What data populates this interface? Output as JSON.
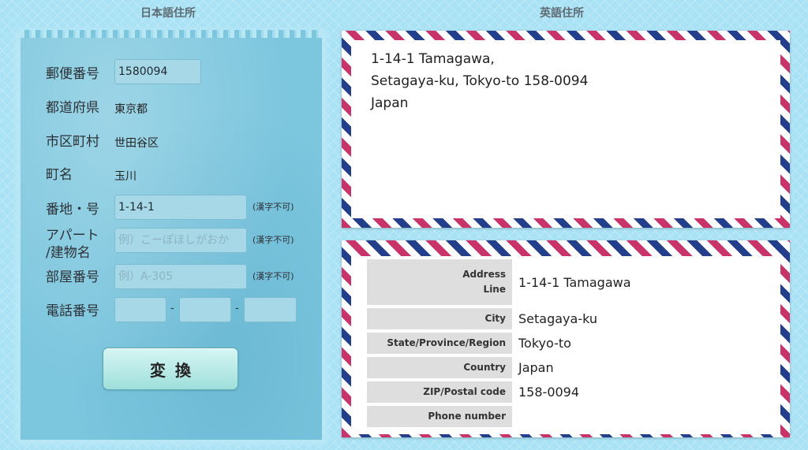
{
  "headings": {
    "japanese_address": "日本語住所",
    "english_address": "英語住所"
  },
  "form": {
    "postal_code": {
      "label": "郵便番号",
      "value": "1580094"
    },
    "prefecture": {
      "label": "都道府県",
      "value": "東京都"
    },
    "city": {
      "label": "市区町村",
      "value": "世田谷区"
    },
    "town": {
      "label": "町名",
      "value": "玉川"
    },
    "block": {
      "label": "番地・号",
      "value": "1-14-1",
      "note": "(漢字不可)"
    },
    "building": {
      "label_line1": "アパート",
      "label_line2": "/建物名",
      "placeholder": "例）こーぽほしがおか",
      "note": "(漢字不可)"
    },
    "room": {
      "label": "部屋番号",
      "placeholder": "例）A-305",
      "note": "(漢字不可)"
    },
    "phone": {
      "label": "電話番号",
      "separator": "-"
    },
    "convert_button": "変換"
  },
  "english_address": {
    "line1": "1-14-1 Tamagawa,",
    "line2": "Setagaya-ku, Tokyo-to 158-0094",
    "line3": "Japan"
  },
  "address_table": {
    "address_line": {
      "label_line1": "Address",
      "label_line2": "Line",
      "value": "1-14-1 Tamagawa"
    },
    "city": {
      "label": "City",
      "value": "Setagaya-ku"
    },
    "state": {
      "label": "State/Province/Region",
      "value": "Tokyo-to"
    },
    "country": {
      "label": "Country",
      "value": "Japan"
    },
    "zip": {
      "label": "ZIP/Postal code",
      "value": "158-0094"
    },
    "phone": {
      "label": "Phone number",
      "value": ""
    }
  },
  "colors": {
    "background": "#a9e2f5",
    "stripe_red": "#c8336a",
    "stripe_blue": "#233f8b",
    "panel": "#7cc6de"
  }
}
